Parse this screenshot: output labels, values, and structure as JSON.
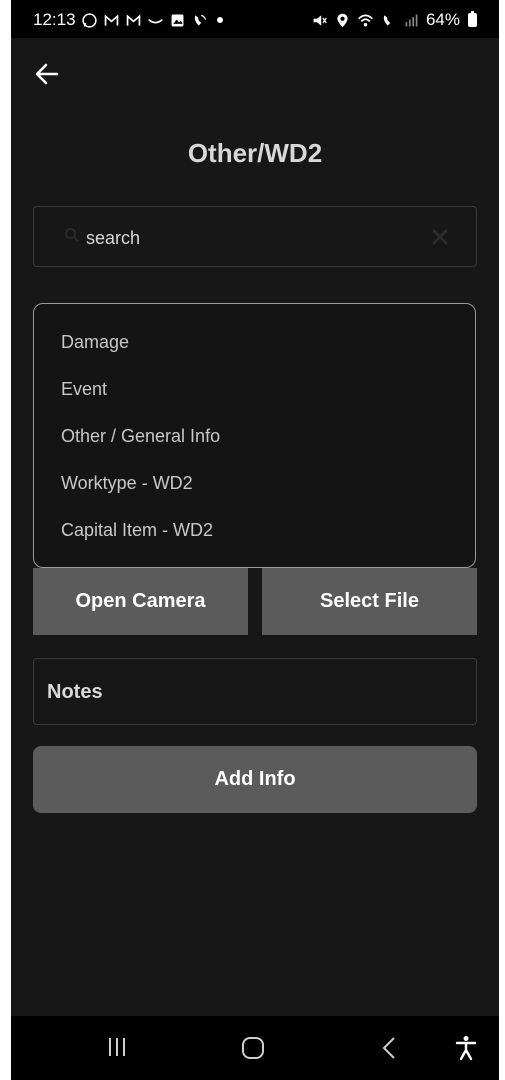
{
  "status_bar": {
    "time": "12:13",
    "battery": "64%",
    "left_icons": [
      "whatsapp-icon",
      "gmail-icon",
      "gmail-icon",
      "messenger-icon",
      "gallery-icon",
      "wifi-calling-icon"
    ],
    "right_icons": [
      "mute-icon",
      "location-icon",
      "wifi-icon",
      "volte-icon",
      "signal-icon",
      "battery-icon"
    ]
  },
  "header": {
    "title": "Other/WD2"
  },
  "search": {
    "placeholder": "search"
  },
  "categories": [
    {
      "label": "Damage"
    },
    {
      "label": "Event"
    },
    {
      "label": "Other / General Info"
    },
    {
      "label": "Worktype - WD2"
    },
    {
      "label": "Capital Item - WD2"
    }
  ],
  "actions": {
    "open_camera": "Open Camera",
    "select_file": "Select File",
    "notes_label": "Notes",
    "add_info": "Add Info"
  },
  "colors": {
    "background": "#171717",
    "button": "#5b5b5b",
    "text": "#d8d8d8"
  },
  "nav_bar": {
    "icons": [
      "recent-apps-icon",
      "home-icon",
      "back-icon",
      "accessibility-icon"
    ]
  }
}
